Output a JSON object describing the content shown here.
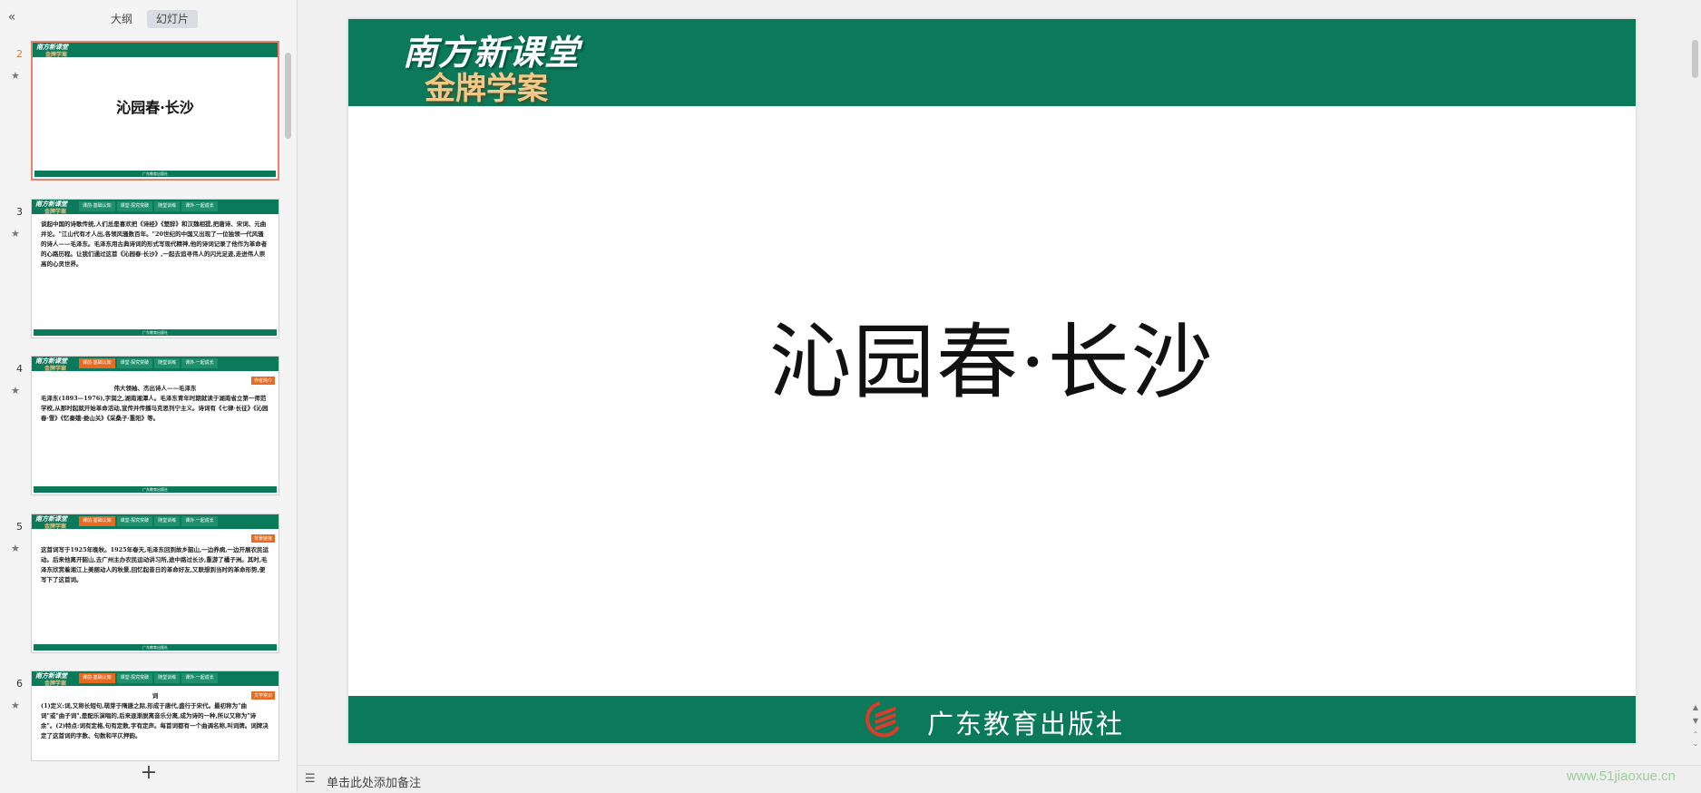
{
  "panel": {
    "collapse_icon": "«",
    "tabs": [
      "大纲",
      "幻灯片"
    ],
    "active_tab": 1,
    "add_icon": "+"
  },
  "thumbs": [
    {
      "num": "2",
      "kind": "title",
      "title": "沁园春·长沙"
    },
    {
      "num": "3",
      "kind": "text",
      "navs": [
        "课前·基础认知",
        "课堂·探究突破",
        "随堂训练",
        "课外·一起成长"
      ],
      "body": "谈起中国的诗歌传统,人们总是喜欢把《诗经》《楚辞》和汉魏相提,把唐诗、宋词、元曲并论。\"江山代有才人出,各领风骚数百年。\"20世纪的中国又出现了一位独领一代风骚的诗人——毛泽东。毛泽东用古典诗词的形式写现代精神,他的诗词记录了他作为革命者的心路历程。让我们通过这首《沁园春·长沙》,一起去追寻伟人的闪光足迹,走进伟人崇高的心灵世界。"
    },
    {
      "num": "4",
      "kind": "text",
      "badge": "作者简介",
      "navs": [
        "课前·基础认知",
        "课堂·探究突破",
        "随堂训练",
        "课外·一起成长"
      ],
      "sub": "伟大领袖、杰出诗人——毛泽东",
      "body": "毛泽东(1893—1976),字润之,湖南湘潭人。毛泽东青年时期就读于湖南省立第一师范学校,从那时起就开始革命活动,宣传并传播马克思列宁主义。诗词有《七律·长征》《沁园春·雪》《忆秦娥·娄山关》《采桑子·重阳》等。"
    },
    {
      "num": "5",
      "kind": "text",
      "badge": "背景链接",
      "navs": [
        "课前·基础认知",
        "课堂·探究突破",
        "随堂训练",
        "课外·一起成长"
      ],
      "body": "这首词写于1925年晚秋。1925年春天,毛泽东回到故乡韶山,一边养病,一边开展农民运动。后来他离开韶山,去广州主办农民运动讲习所,途中路过长沙,重游了橘子洲。其时,毛泽东欣赏着湘江上美丽动人的秋景,回忆起昔日的革命好友,又联想到当时的革命形势,便写下了这首词。"
    },
    {
      "num": "6",
      "kind": "text",
      "badge": "文学常识",
      "navs": [
        "课前·基础认知",
        "课堂·探究突破",
        "随堂训练",
        "课外·一起成长"
      ],
      "sub": "词",
      "body": "(1)定义:词,又称长短句,萌芽于隋唐之际,形成于唐代,盛行于宋代。最初称为\"曲词\"或\"曲子词\",是配乐演唱的,后来逐渐脱离音乐分离,成为诗的一种,所以又称为\"诗余\"。(2)特点:词有定格,句有定数,字有定声。每首词都有一个曲调名称,叫词牌。词牌决定了这首词的字数、句数和平仄押韵。"
    }
  ],
  "thumb_logo": {
    "line1": "南方新课堂",
    "line2": "金牌学案"
  },
  "thumb_footer": "广东教育出版社",
  "slide": {
    "logo_line1": "南方新课堂",
    "logo_line2": "金牌学案",
    "title": "沁园春·长沙",
    "publisher": "广东教育出版社"
  },
  "notes": {
    "placeholder": "单击此处添加备注",
    "icon": "notes-lines-icon"
  },
  "watermark": "www.51jiaoxue.cn",
  "colors": {
    "brand_green": "#0a7a5a",
    "accent_orange": "#e86a20",
    "selection": "#e8826a"
  }
}
